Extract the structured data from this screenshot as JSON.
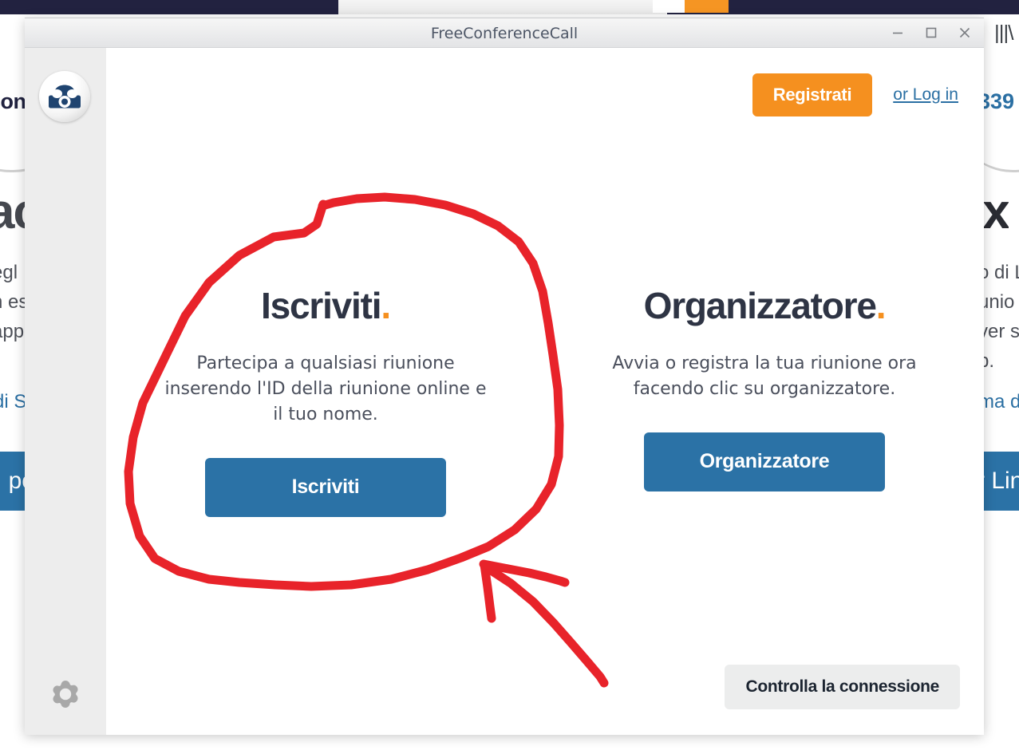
{
  "window": {
    "title": "FreeConferenceCall",
    "controls": [
      {
        "name": "minimize",
        "glyph": "minimize-icon"
      },
      {
        "name": "maximize",
        "glyph": "maximize-icon"
      },
      {
        "name": "close",
        "glyph": "close-icon"
      }
    ]
  },
  "sidebar": {
    "logo_icon": "telephone-logo-icon",
    "settings_icon": "gear-icon"
  },
  "header": {
    "register_label": "Registrati",
    "login_label": "or Log in",
    "register_color": "#f5901f",
    "login_color": "#2a6fa3"
  },
  "panels": [
    {
      "title": "Iscriviti",
      "title_dot": ".",
      "description": "Partecipa a qualsiasi riunione inserendo l'ID della riunione online e il tuo nome.",
      "button_label": "Iscriviti",
      "button_color": "#2b72a6"
    },
    {
      "title": "Organizzatore",
      "title_dot": ".",
      "description": "Avvia o registra la tua riunione ora facendo clic su organizzatore.",
      "button_label": "Organizzatore",
      "button_color": "#2b72a6"
    }
  ],
  "footer": {
    "check_connection_label": "Controlla la connessione"
  },
  "annotation": {
    "color": "#e8232a",
    "shapes": [
      "hand-drawn-circle-around-iscriviti",
      "hand-drawn-arrow-pointing-to-circle"
    ]
  },
  "background_page": {
    "phone_fragment_left": "con",
    "phone_fragment_right": "339",
    "heading_fragment_left": "ac",
    "heading_fragment_right": "ıx",
    "body_lines_left": [
      "egl",
      "n es",
      "app"
    ],
    "body_lines_right": [
      "o di L",
      "unio",
      "ver s",
      "p."
    ],
    "link_fragment_left": "di S",
    "link_fragment_right": "ma d",
    "button_fragment_left": "po",
    "button_fragment_right": "r Lin"
  },
  "browser_chrome": {
    "library_icon": "library-icon"
  }
}
